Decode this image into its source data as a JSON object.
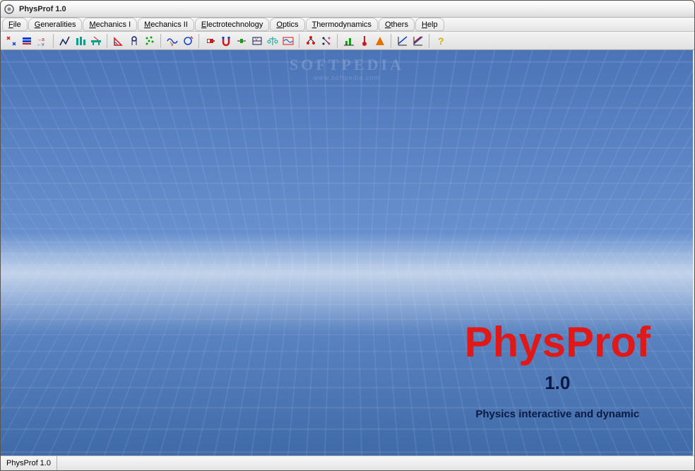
{
  "window": {
    "title": "PhysProf 1.0"
  },
  "menu": [
    {
      "label": "File",
      "ul": "F",
      "rest": "ile"
    },
    {
      "label": "Generalities",
      "ul": "G",
      "rest": "eneralities"
    },
    {
      "label": "Mechanics I",
      "ul": "M",
      "rest": "echanics I"
    },
    {
      "label": "Mechanics II",
      "ul": "M",
      "rest": "echanics II"
    },
    {
      "label": "Electrotechnology",
      "ul": "E",
      "rest": "lectrotechnology"
    },
    {
      "label": "Optics",
      "ul": "O",
      "rest": "ptics"
    },
    {
      "label": "Thermodynamics",
      "ul": "T",
      "rest": "hermodynamics"
    },
    {
      "label": "Others",
      "ul": "O",
      "rest": "thers"
    },
    {
      "label": "Help",
      "ul": "H",
      "rest": "elp"
    }
  ],
  "toolbar_groups": [
    [
      "arrows-converge-icon",
      "stack-blue-icon",
      "convert-av-icon"
    ],
    [
      "mountain-graph-icon",
      "pillars-icon",
      "bridge-icon"
    ],
    [
      "angle-ruler-icon",
      "pulley-icon",
      "cluster-dots-icon"
    ],
    [
      "wave-v-icon",
      "cycle-graph-icon"
    ],
    [
      "battery-icon",
      "magnet-icon",
      "slider-green-icon",
      "voltmeter-icon",
      "balance-teal-icon",
      "waveform-box-icon"
    ],
    [
      "tree-red-icon",
      "nodes-small-icon"
    ],
    [
      "bar-green-icon",
      "thermometer-icon",
      "triangle-orange-icon"
    ],
    [
      "slope-blue-icon",
      "slope-double-icon"
    ],
    [
      "help-icon"
    ]
  ],
  "watermark": {
    "big": "SOFTPEDIA",
    "small": "www.softpedia.com"
  },
  "splash": {
    "brand": "PhysProf",
    "version": "1.0",
    "tagline": "Physics interactive and dynamic"
  },
  "statusbar": {
    "text": "PhysProf 1.0"
  },
  "colors": {
    "accent_red": "#e01818",
    "accent_navy": "#0a1a44",
    "bg_blue": "#4b74b8"
  }
}
